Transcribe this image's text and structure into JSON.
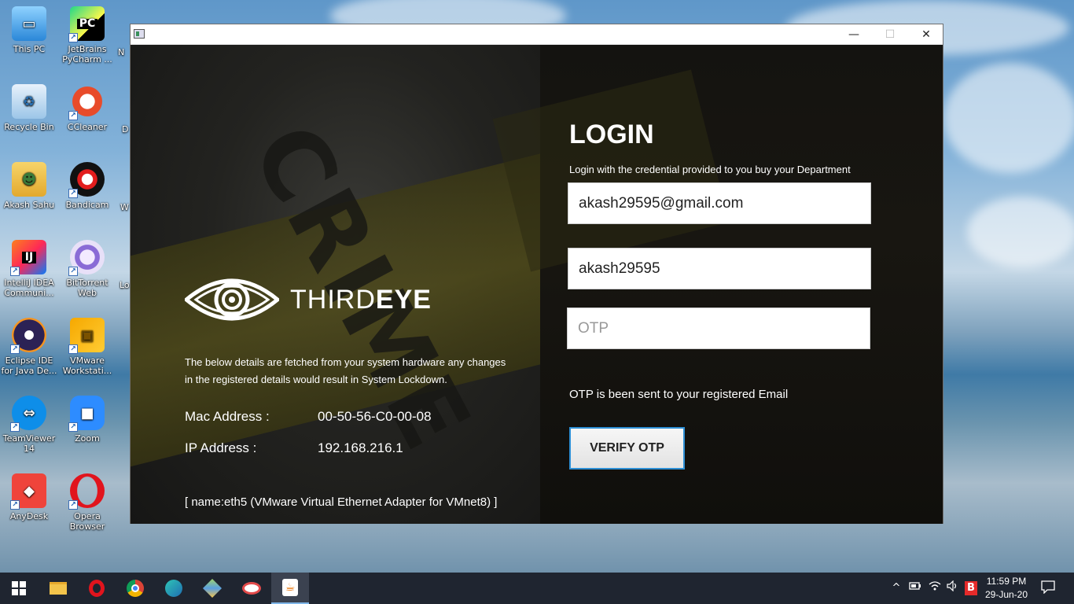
{
  "desktop": {
    "icons": [
      {
        "label": "This PC",
        "icon": "computer-icon"
      },
      {
        "label": "JetBrains PyCharm ...",
        "icon": "pycharm-icon"
      },
      {
        "label": "Recycle Bin",
        "icon": "recycle-bin-icon"
      },
      {
        "label": "CCleaner",
        "icon": "ccleaner-icon"
      },
      {
        "label": "Akash Sahu",
        "icon": "user-folder-icon"
      },
      {
        "label": "Bandicam",
        "icon": "bandicam-icon"
      },
      {
        "label": "IntelliJ IDEA Communi...",
        "icon": "intellij-icon"
      },
      {
        "label": "BitTorrent Web",
        "icon": "bittorrent-icon"
      },
      {
        "label": "Eclipse IDE for Java De...",
        "icon": "eclipse-icon"
      },
      {
        "label": "VMware Workstati...",
        "icon": "vmware-icon"
      },
      {
        "label": "TeamViewer 14",
        "icon": "teamviewer-icon"
      },
      {
        "label": "Zoom",
        "icon": "zoom-icon"
      },
      {
        "label": "AnyDesk",
        "icon": "anydesk-icon"
      },
      {
        "label": "Opera Browser",
        "icon": "opera-icon"
      }
    ],
    "partial_labels": [
      "N",
      "D",
      "W",
      "Lo"
    ]
  },
  "window": {
    "controls": {
      "minimize": "—",
      "maximize": "☐",
      "close": "✕"
    }
  },
  "brand": {
    "name_light": "THIRD",
    "name_bold": "EYE",
    "background_word": "CRIME"
  },
  "system_info": {
    "description": "The below details are fetched from your system hardware any changes in the registered details would result in System Lockdown.",
    "mac_label": "Mac Address :",
    "mac_value": "00-50-56-C0-00-08",
    "ip_label": "IP Address     :",
    "ip_value": "192.168.216.1",
    "adapter": "[ name:eth5 (VMware Virtual Ethernet Adapter for VMnet8) ]"
  },
  "login": {
    "title": "LOGIN",
    "subtitle": "Login with the credential provided to you buy your Department",
    "email_value": "akash29595@gmail.com",
    "password_value": "akash29595",
    "otp_placeholder": "OTP",
    "otp_note": "OTP is been sent to your registered Email",
    "verify_label": "VERIFY OTP"
  },
  "taskbar": {
    "items": [
      "start-icon",
      "file-explorer-icon",
      "opera-icon",
      "chrome-icon",
      "edge-dev-icon",
      "box-icon",
      "snipping-icon",
      "java-icon"
    ],
    "tray": {
      "chevron": "^",
      "battery": "🔋",
      "wifi": "◠",
      "volume": "🔊",
      "bitdefender": "B"
    },
    "time": "11:59 PM",
    "date": "29-Jun-20"
  },
  "colors": {
    "accent_blue": "#2d8fd5",
    "window_bg": "#0b0b0b",
    "taskbar_bg": "#1f2530"
  }
}
